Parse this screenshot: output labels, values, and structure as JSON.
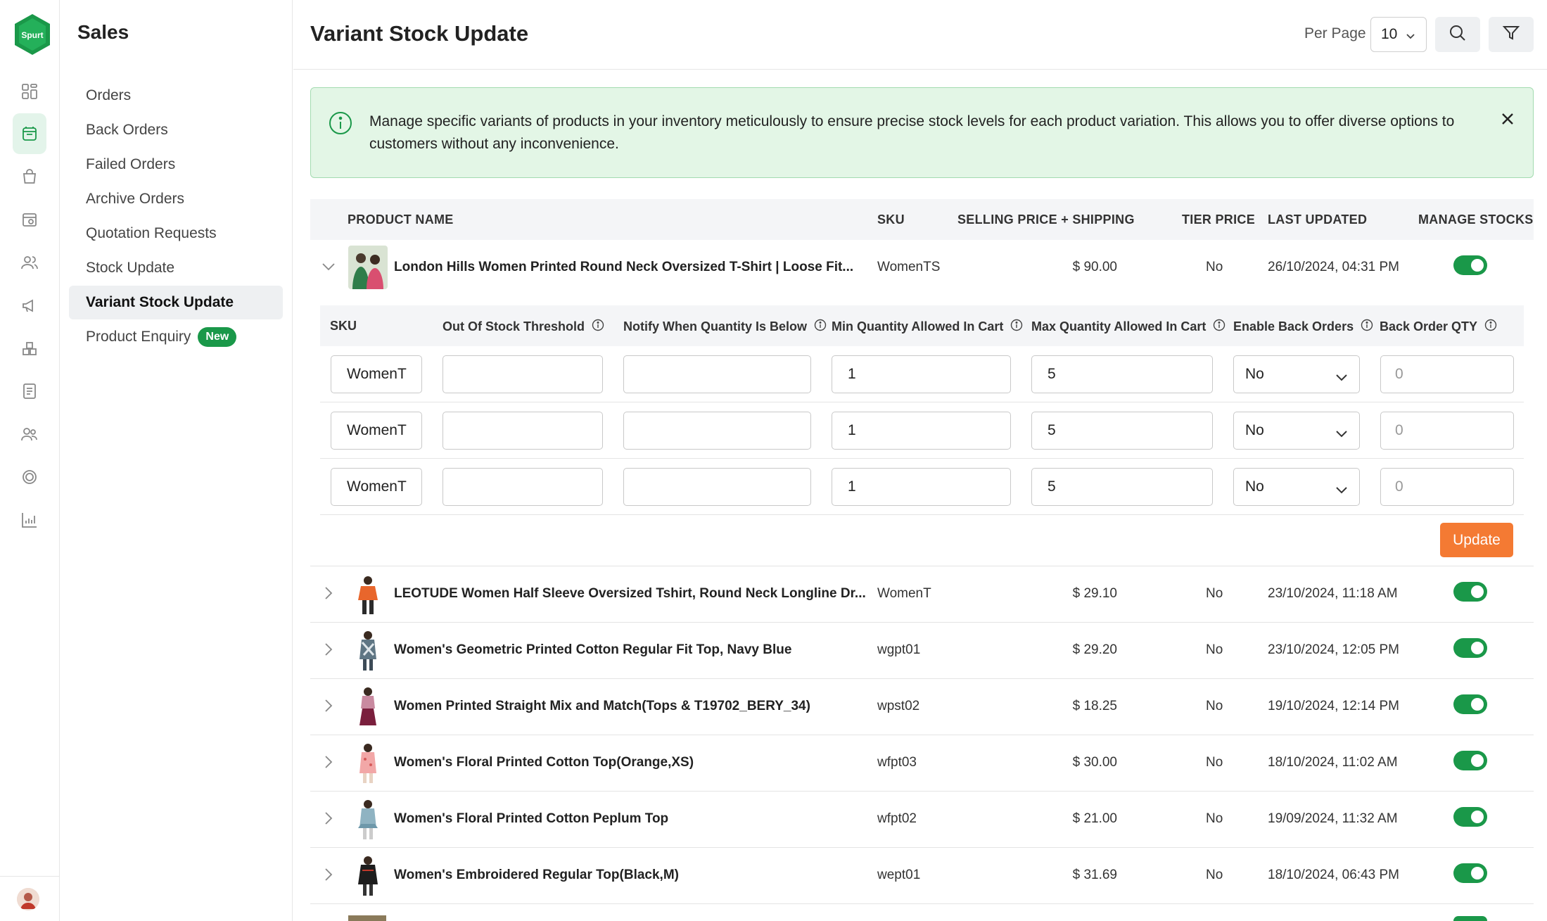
{
  "app": {
    "section_title": "Sales",
    "logo_text": "Spurt"
  },
  "rail": {
    "icons": [
      "dashboard-icon",
      "sales-icon",
      "shopping-bag-icon",
      "store-icon",
      "users-icon",
      "megaphone-icon",
      "boxes-icon",
      "document-icon",
      "team-icon",
      "coin-icon",
      "chart-icon"
    ]
  },
  "sidebar": {
    "items": [
      {
        "label": "Orders"
      },
      {
        "label": "Back Orders"
      },
      {
        "label": "Failed Orders"
      },
      {
        "label": "Archive Orders"
      },
      {
        "label": "Quotation Requests"
      },
      {
        "label": "Stock Update"
      },
      {
        "label": "Variant Stock Update"
      },
      {
        "label": "Product Enquiry",
        "badge": "New"
      }
    ],
    "active": "Variant Stock Update"
  },
  "header": {
    "title": "Variant Stock Update",
    "per_page_label": "Per Page",
    "per_page_value": "10"
  },
  "alert": {
    "text": "Manage specific variants of products in your inventory meticulously to ensure precise stock levels for each product variation. This allows you to offer diverse options to customers without any inconvenience."
  },
  "table": {
    "headers": {
      "product_name": "PRODUCT NAME",
      "sku": "SKU",
      "price": "SELLING PRICE + SHIPPING",
      "tier": "TIER PRICE",
      "updated": "LAST UPDATED",
      "manage": "MANAGE STOCKS"
    },
    "rows": [
      {
        "name": "London Hills Women Printed Round Neck Oversized T-Shirt | Loose Fit...",
        "sku": "WomenTS",
        "price": "$ 90.00",
        "tier": "No",
        "updated": "26/10/2024, 04:31 PM",
        "manage": true,
        "expanded": true
      },
      {
        "name": "LEOTUDE Women Half Sleeve Oversized Tshirt, Round Neck Longline Dr...",
        "sku": "WomenT",
        "price": "$ 29.10",
        "tier": "No",
        "updated": "23/10/2024, 11:18 AM",
        "manage": true
      },
      {
        "name": "Women's Geometric Printed Cotton Regular Fit Top, Navy Blue",
        "sku": "wgpt01",
        "price": "$ 29.20",
        "tier": "No",
        "updated": "23/10/2024, 12:05 PM",
        "manage": true
      },
      {
        "name": "Women Printed Straight Mix and Match(Tops & T19702_BERY_34)",
        "sku": "wpst02",
        "price": "$ 18.25",
        "tier": "No",
        "updated": "19/10/2024, 12:14 PM",
        "manage": true
      },
      {
        "name": "Women's Floral Printed Cotton Top(Orange,XS)",
        "sku": "wfpt03",
        "price": "$ 30.00",
        "tier": "No",
        "updated": "18/10/2024, 11:02 AM",
        "manage": true
      },
      {
        "name": "Women's Floral Printed Cotton Peplum Top",
        "sku": "wfpt02",
        "price": "$ 21.00",
        "tier": "No",
        "updated": "19/09/2024, 11:32 AM",
        "manage": true
      },
      {
        "name": "Women's Embroidered Regular Top(Black,M)",
        "sku": "wept01",
        "price": "$ 31.69",
        "tier": "No",
        "updated": "18/10/2024, 06:43 PM",
        "manage": true
      }
    ]
  },
  "variants": {
    "headers": {
      "sku": "SKU",
      "threshold": "Out Of Stock Threshold",
      "notify": "Notify When Quantity Is Below",
      "min_qty": "Min Quantity Allowed In Cart",
      "max_qty": "Max Quantity Allowed In Cart",
      "back_orders": "Enable Back Orders",
      "back_qty": "Back Order QTY"
    },
    "rows": [
      {
        "sku": "WomenT",
        "threshold": "",
        "notify": "",
        "min_qty": "1",
        "max_qty": "5",
        "back_orders": "No",
        "back_qty_placeholder": "0"
      },
      {
        "sku": "WomenT",
        "threshold": "",
        "notify": "",
        "min_qty": "1",
        "max_qty": "5",
        "back_orders": "No",
        "back_qty_placeholder": "0"
      },
      {
        "sku": "WomenT",
        "threshold": "",
        "notify": "",
        "min_qty": "1",
        "max_qty": "5",
        "back_orders": "No",
        "back_qty_placeholder": "0"
      }
    ],
    "update_label": "Update"
  },
  "colors": {
    "accent_green": "#1a9849",
    "update_orange": "#f47a33",
    "alert_bg": "#e3f6e6"
  }
}
